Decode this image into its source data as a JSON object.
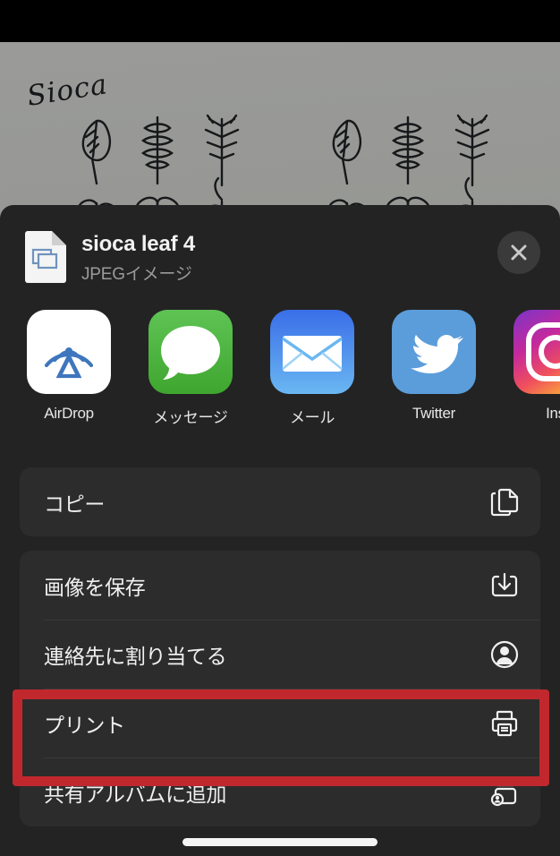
{
  "background": {
    "signature": "Sioca",
    "artwork_name": "hand-drawn-leaf-illustrations"
  },
  "sheet": {
    "file": {
      "title": "sioca leaf 4",
      "kind": "JPEGイメージ",
      "icon": "jpeg-document-icon"
    },
    "close_label": "×",
    "apps": [
      {
        "label": "AirDrop",
        "icon": "airdrop-icon",
        "tile": "tile-airdrop"
      },
      {
        "label": "メッセージ",
        "icon": "messages-icon",
        "tile": "tile-messages"
      },
      {
        "label": "メール",
        "icon": "mail-icon",
        "tile": "tile-mail"
      },
      {
        "label": "Twitter",
        "icon": "twitter-icon",
        "tile": "tile-twitter"
      },
      {
        "label": "Ins",
        "icon": "instagram-icon",
        "tile": "tile-instagram"
      }
    ],
    "action_groups": [
      {
        "rows": [
          {
            "label": "コピー",
            "icon": "copy-icon"
          }
        ]
      },
      {
        "rows": [
          {
            "label": "画像を保存",
            "icon": "save-image-icon"
          },
          {
            "label": "連絡先に割り当てる",
            "icon": "assign-contact-icon"
          },
          {
            "label": "プリント",
            "icon": "print-icon"
          },
          {
            "label": "共有アルバムに追加",
            "icon": "shared-album-icon"
          }
        ]
      }
    ]
  },
  "annotation": {
    "target_label": "プリント",
    "color": "#c0282d"
  },
  "colors": {
    "sheet_background": "#232323",
    "card_background": "#2c2c2c",
    "text_primary": "#f0f0f0",
    "text_secondary": "#9b9b9b",
    "highlight": "#c0282d"
  }
}
